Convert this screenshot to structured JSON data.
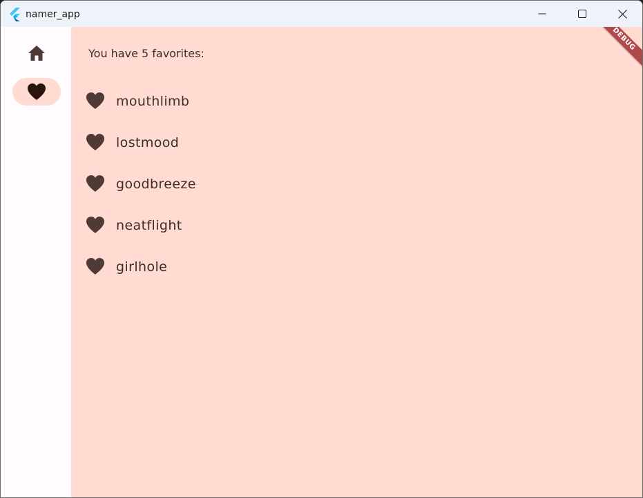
{
  "window": {
    "title": "namer_app"
  },
  "nav": {
    "items": [
      {
        "icon": "home-icon",
        "selected": false
      },
      {
        "icon": "heart-icon",
        "selected": true
      }
    ]
  },
  "favorites": {
    "count_text": "You have 5 favorites:",
    "items": [
      "mouthlimb",
      "lostmood",
      "goodbreeze",
      "neatflight",
      "girlhole"
    ]
  },
  "debug_banner": "DEBUG",
  "colors": {
    "content_bg": "#ffdbd2",
    "selected_indicator": "#ffdbd1",
    "icon": "#4e3b36",
    "banner": "#b04a4a"
  }
}
